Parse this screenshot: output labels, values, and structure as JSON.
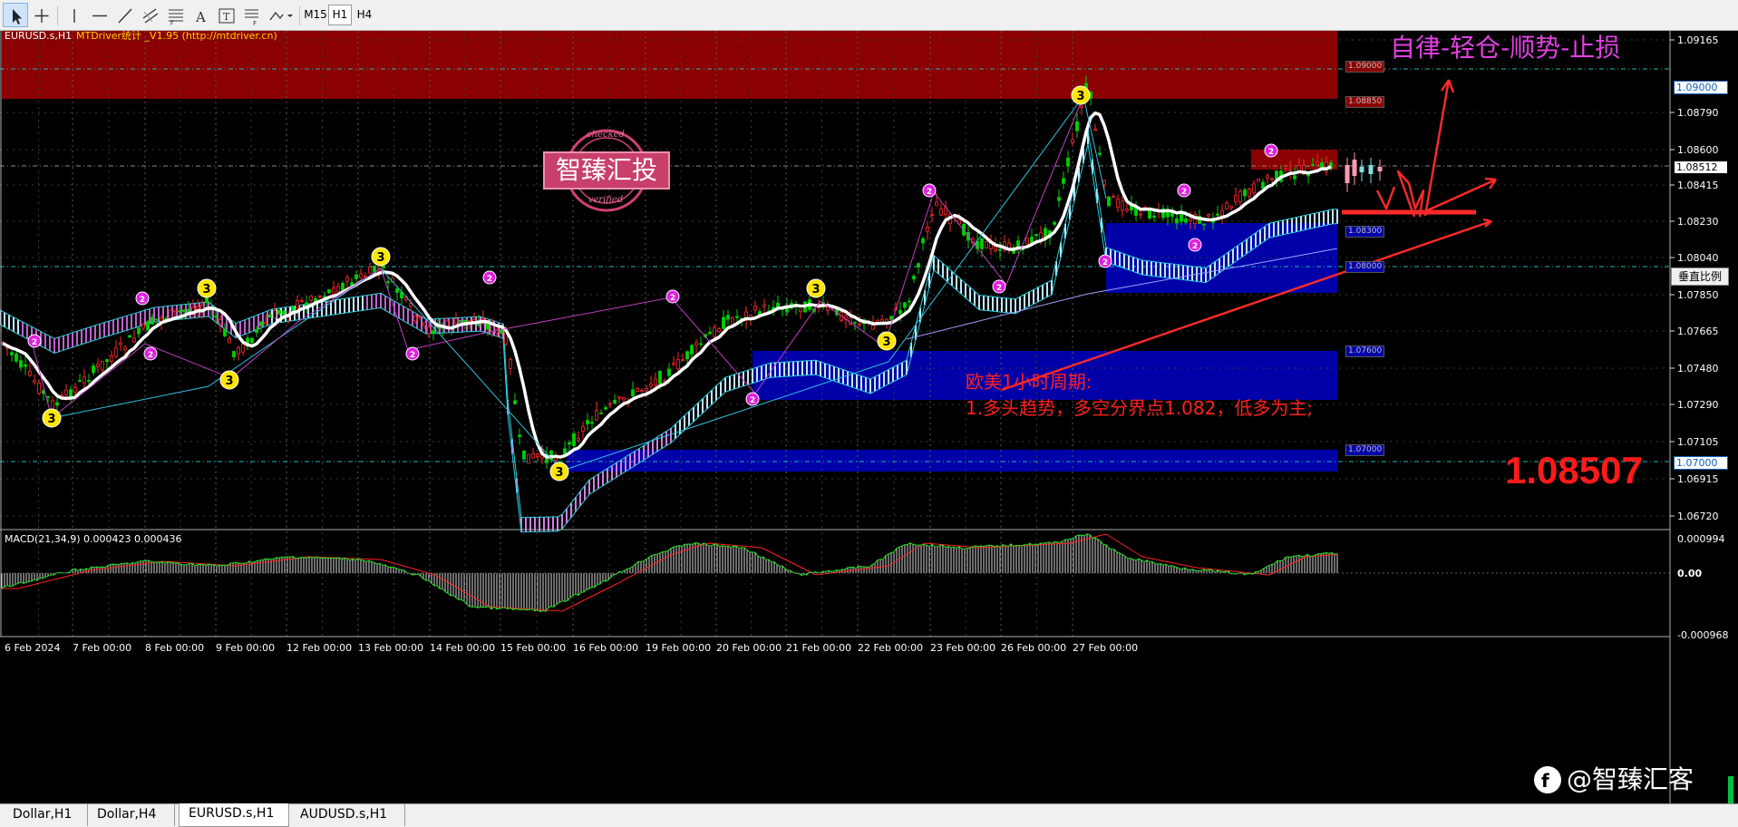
{
  "window": {
    "symbol_title": "EURUSD.s,H1",
    "indicator_title": "MTDriver统计 _V1.95 (http://mtdriver.cn)"
  },
  "toolbar": {
    "tools": [
      "cursor-icon",
      "crosshair-icon",
      "vertical-line-icon",
      "horizontal-line-icon",
      "trendline-icon",
      "channel-icon",
      "fibonacci-icon",
      "text-icon",
      "text-label-icon",
      "fibo-fan-icon",
      "shapes-icon"
    ],
    "timeframes": [
      {
        "label": "M15",
        "active": false
      },
      {
        "label": "H1",
        "active": true
      },
      {
        "label": "H4",
        "active": false
      }
    ]
  },
  "price_axis": {
    "labels": [
      "1.09165",
      "1.08790",
      "1.08600",
      "1.08415",
      "1.08230",
      "1.08040",
      "1.07850",
      "1.07665",
      "1.07480",
      "1.07290",
      "1.07105",
      "1.06915",
      "1.06720"
    ],
    "highlight_labels": [
      {
        "text": "1.09000",
        "style": "highlight"
      },
      {
        "text": "1.08512",
        "style": "current"
      },
      {
        "text": "1.07000",
        "style": "highlight"
      }
    ],
    "vertical_scale_label": "垂直比例"
  },
  "level_tags": [
    "1.09000",
    "1.08850",
    "1.08300",
    "1.08000",
    "1.07600",
    "1.07000"
  ],
  "macd": {
    "title": "MACD(21,34,9) 0.000423 0.000436",
    "axis_labels": [
      "0.000994",
      "0.00",
      "-0.000968"
    ]
  },
  "time_axis": {
    "labels": [
      "6 Feb 2024",
      "7 Feb 00:00",
      "8 Feb 00:00",
      "9 Feb 00:00",
      "12 Feb 00:00",
      "13 Feb 00:00",
      "14 Feb 00:00",
      "15 Feb 00:00",
      "16 Feb 00:00",
      "19 Feb 00:00",
      "20 Feb 00:00",
      "21 Feb 00:00",
      "22 Feb 00:00",
      "23 Feb 00:00",
      "26 Feb 00:00",
      "27 Feb 00:00"
    ]
  },
  "annotations": {
    "slogan": "自律-轻仓-顺势-止损",
    "analysis_title": "欧美1小时周期:",
    "analysis_line1": "1.多头趋势，多空分界点1.082，低多为主;",
    "big_price": "1.08507",
    "watermark_text": "智臻汇投",
    "watermark_ring_top": "checked",
    "watermark_ring_bottom": "verified",
    "wave_marks": [
      "3",
      "2"
    ]
  },
  "footer_watermark": {
    "text": "@智臻汇客"
  },
  "tabs": [
    {
      "label": "Dollar,H1",
      "active": false
    },
    {
      "label": "Dollar,H4",
      "active": false
    },
    {
      "label": "EURUSD.s,H1",
      "active": true
    },
    {
      "label": "AUDUSD.s,H1",
      "active": false
    }
  ],
  "colors": {
    "bull_candle": "#00d000",
    "bear_candle": "#ff2a2a",
    "resistance_zone": "#8b0000",
    "support_zone": "#0000a8",
    "slogan": "#e040e0",
    "analysis_text": "#ff2020",
    "ma_line": "#ffffff"
  }
}
